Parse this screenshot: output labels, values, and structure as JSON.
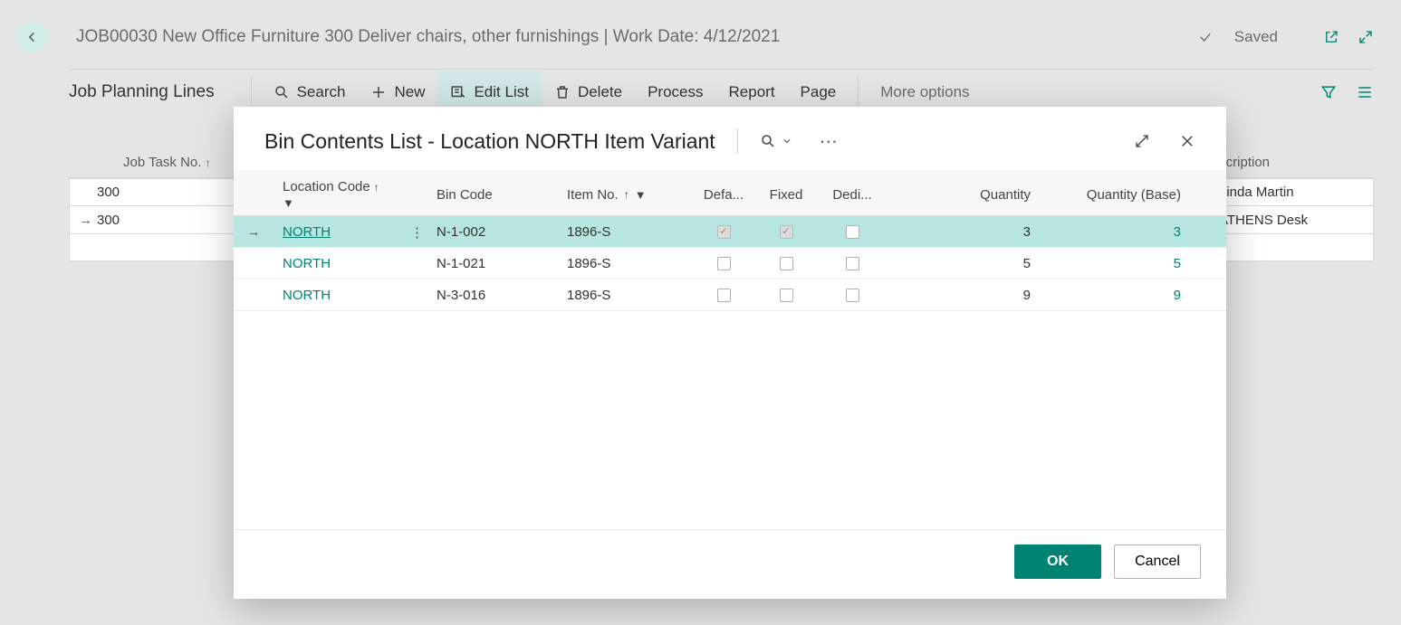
{
  "header": {
    "title": "JOB00030 New Office Furniture 300 Deliver chairs, other furnishings | Work Date: 4/12/2021",
    "saved_label": "Saved"
  },
  "cmdbar": {
    "section_title": "Job Planning Lines",
    "search": "Search",
    "new": "New",
    "edit_list": "Edit List",
    "delete": "Delete",
    "process": "Process",
    "report": "Report",
    "page": "Page",
    "more": "More options"
  },
  "grid": {
    "columns": {
      "task": "Job Task No.",
      "description": "Description"
    },
    "rows": [
      {
        "task": "300",
        "description": "Linda Martin",
        "selected": false
      },
      {
        "task": "300",
        "description": "ATHENS Desk",
        "selected": true
      }
    ]
  },
  "modal": {
    "title": "Bin Contents List - Location NORTH Item Variant",
    "columns": {
      "location": "Location Code",
      "bin": "Bin Code",
      "item": "Item No.",
      "default": "Defa...",
      "fixed": "Fixed",
      "dedicated": "Dedi...",
      "qty": "Quantity",
      "qty_base": "Quantity (Base)"
    },
    "rows": [
      {
        "location": "NORTH",
        "bin": "N-1-002",
        "item": "1896-S",
        "default": true,
        "fixed": true,
        "dedicated": false,
        "qty": "3",
        "qty_base": "3",
        "selected": true
      },
      {
        "location": "NORTH",
        "bin": "N-1-021",
        "item": "1896-S",
        "default": false,
        "fixed": false,
        "dedicated": false,
        "qty": "5",
        "qty_base": "5",
        "selected": false
      },
      {
        "location": "NORTH",
        "bin": "N-3-016",
        "item": "1896-S",
        "default": false,
        "fixed": false,
        "dedicated": false,
        "qty": "9",
        "qty_base": "9",
        "selected": false
      }
    ],
    "footer": {
      "ok": "OK",
      "cancel": "Cancel"
    }
  }
}
